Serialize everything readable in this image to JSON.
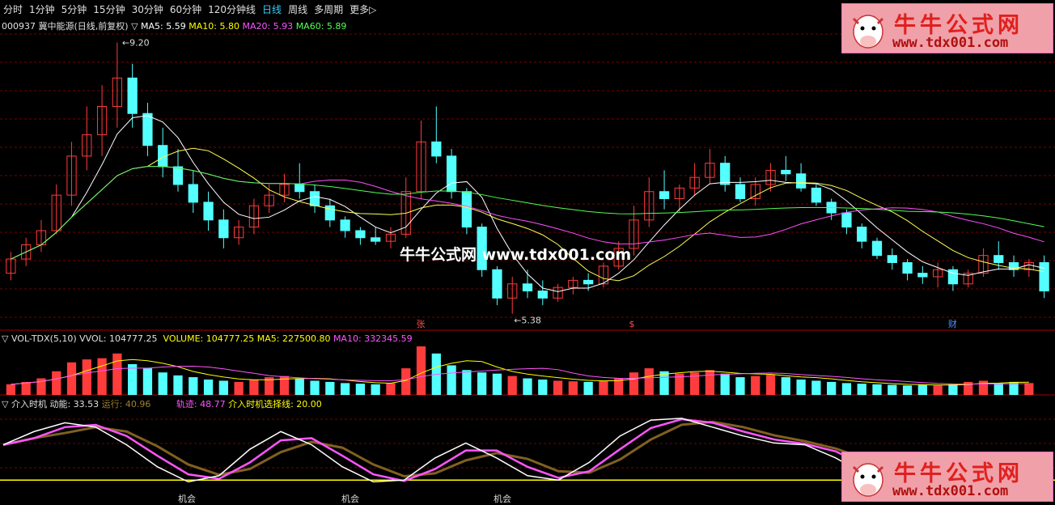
{
  "tabs": [
    "分时",
    "1分钟",
    "5分钟",
    "15分钟",
    "30分钟",
    "60分钟",
    "120分钟线",
    "日线",
    "周线",
    "多周期",
    "更多▷"
  ],
  "active_tab": "日线",
  "price_panel": {
    "title": "000937 冀中能源(日线,前复权) ▽",
    "ma5": "MA5: 5.59",
    "ma10": "MA10: 5.80",
    "ma20": "MA20: 5.93",
    "ma60": "MA60: 5.89",
    "high_label": "9.20",
    "low_label": "5.38",
    "markers": [
      "张",
      "$",
      "财"
    ]
  },
  "vol_panel": {
    "name": "▽ VOL-TDX(5,10)",
    "vvol": "VVOL: 104777.25",
    "volume": "VOLUME: 104777.25",
    "ma5": "MA5: 227500.80",
    "ma10": "MA10: 332345.59"
  },
  "ind_panel": {
    "name": "▽ 介入时机",
    "dongneng": "动能: 33.53",
    "yunxing": "运行: 40.96",
    "guiji": "轨迹: 48.77",
    "xuanze": "介入时机选择线: 20.00",
    "signals": [
      "机会",
      "机会",
      "机会"
    ]
  },
  "watermark": {
    "cn": "牛牛公式网",
    "url": "www.tdx001.com",
    "center": "牛牛公式网  www.tdx001.com"
  },
  "colors": {
    "up": "#ff3c3c",
    "down": "#54ffff",
    "ma5": "#ffffff",
    "ma10": "#ffff50",
    "ma20": "#ff50ff",
    "ma60": "#50ff50",
    "grid": "#7a0000"
  },
  "chart_data": {
    "type": "candlestick",
    "price_range": [
      5.38,
      9.2
    ],
    "candles": [
      {
        "o": 5.95,
        "h": 6.25,
        "l": 5.85,
        "c": 6.15
      },
      {
        "o": 6.15,
        "h": 6.45,
        "l": 6.05,
        "c": 6.35
      },
      {
        "o": 6.35,
        "h": 6.7,
        "l": 6.25,
        "c": 6.55
      },
      {
        "o": 6.55,
        "h": 7.2,
        "l": 6.5,
        "c": 7.05
      },
      {
        "o": 7.05,
        "h": 7.8,
        "l": 6.9,
        "c": 7.6
      },
      {
        "o": 7.6,
        "h": 8.3,
        "l": 7.4,
        "c": 7.9
      },
      {
        "o": 7.9,
        "h": 8.6,
        "l": 7.6,
        "c": 8.3
      },
      {
        "o": 8.3,
        "h": 9.2,
        "l": 8.0,
        "c": 8.7
      },
      {
        "o": 8.7,
        "h": 8.9,
        "l": 8.0,
        "c": 8.2
      },
      {
        "o": 8.2,
        "h": 8.35,
        "l": 7.6,
        "c": 7.75
      },
      {
        "o": 7.75,
        "h": 8.0,
        "l": 7.3,
        "c": 7.45
      },
      {
        "o": 7.45,
        "h": 7.7,
        "l": 7.1,
        "c": 7.2
      },
      {
        "o": 7.2,
        "h": 7.4,
        "l": 6.8,
        "c": 6.95
      },
      {
        "o": 6.95,
        "h": 7.1,
        "l": 6.55,
        "c": 6.7
      },
      {
        "o": 6.7,
        "h": 6.85,
        "l": 6.3,
        "c": 6.45
      },
      {
        "o": 6.45,
        "h": 6.7,
        "l": 6.35,
        "c": 6.6
      },
      {
        "o": 6.6,
        "h": 7.0,
        "l": 6.5,
        "c": 6.9
      },
      {
        "o": 6.9,
        "h": 7.2,
        "l": 6.8,
        "c": 7.05
      },
      {
        "o": 7.05,
        "h": 7.35,
        "l": 6.95,
        "c": 7.2
      },
      {
        "o": 7.2,
        "h": 7.5,
        "l": 7.0,
        "c": 7.1
      },
      {
        "o": 7.1,
        "h": 7.2,
        "l": 6.8,
        "c": 6.9
      },
      {
        "o": 6.9,
        "h": 7.0,
        "l": 6.6,
        "c": 6.7
      },
      {
        "o": 6.7,
        "h": 6.75,
        "l": 6.45,
        "c": 6.55
      },
      {
        "o": 6.55,
        "h": 6.6,
        "l": 6.35,
        "c": 6.45
      },
      {
        "o": 6.45,
        "h": 6.6,
        "l": 6.35,
        "c": 6.4
      },
      {
        "o": 6.4,
        "h": 6.6,
        "l": 6.3,
        "c": 6.5
      },
      {
        "o": 6.5,
        "h": 7.3,
        "l": 6.45,
        "c": 7.1
      },
      {
        "o": 7.1,
        "h": 8.1,
        "l": 7.0,
        "c": 7.8
      },
      {
        "o": 7.8,
        "h": 8.3,
        "l": 7.5,
        "c": 7.6
      },
      {
        "o": 7.6,
        "h": 7.7,
        "l": 7.0,
        "c": 7.1
      },
      {
        "o": 7.1,
        "h": 7.15,
        "l": 6.5,
        "c": 6.6
      },
      {
        "o": 6.6,
        "h": 6.65,
        "l": 5.9,
        "c": 6.0
      },
      {
        "o": 6.0,
        "h": 6.05,
        "l": 5.5,
        "c": 5.6
      },
      {
        "o": 5.6,
        "h": 5.9,
        "l": 5.38,
        "c": 5.8
      },
      {
        "o": 5.8,
        "h": 6.0,
        "l": 5.6,
        "c": 5.7
      },
      {
        "o": 5.7,
        "h": 5.85,
        "l": 5.5,
        "c": 5.6
      },
      {
        "o": 5.6,
        "h": 5.8,
        "l": 5.55,
        "c": 5.75
      },
      {
        "o": 5.75,
        "h": 5.9,
        "l": 5.65,
        "c": 5.85
      },
      {
        "o": 5.85,
        "h": 5.95,
        "l": 5.7,
        "c": 5.8
      },
      {
        "o": 5.8,
        "h": 6.1,
        "l": 5.75,
        "c": 6.05
      },
      {
        "o": 6.05,
        "h": 6.4,
        "l": 6.0,
        "c": 6.3
      },
      {
        "o": 6.3,
        "h": 6.9,
        "l": 6.2,
        "c": 6.7
      },
      {
        "o": 6.7,
        "h": 7.3,
        "l": 6.6,
        "c": 7.1
      },
      {
        "o": 7.1,
        "h": 7.4,
        "l": 6.85,
        "c": 7.0
      },
      {
        "o": 7.0,
        "h": 7.2,
        "l": 6.8,
        "c": 7.15
      },
      {
        "o": 7.15,
        "h": 7.5,
        "l": 7.05,
        "c": 7.3
      },
      {
        "o": 7.3,
        "h": 7.7,
        "l": 7.2,
        "c": 7.5
      },
      {
        "o": 7.5,
        "h": 7.6,
        "l": 7.1,
        "c": 7.2
      },
      {
        "o": 7.2,
        "h": 7.3,
        "l": 6.95,
        "c": 7.0
      },
      {
        "o": 7.0,
        "h": 7.3,
        "l": 6.9,
        "c": 7.2
      },
      {
        "o": 7.2,
        "h": 7.5,
        "l": 7.1,
        "c": 7.4
      },
      {
        "o": 7.4,
        "h": 7.6,
        "l": 7.25,
        "c": 7.35
      },
      {
        "o": 7.35,
        "h": 7.5,
        "l": 7.1,
        "c": 7.15
      },
      {
        "o": 7.15,
        "h": 7.2,
        "l": 6.9,
        "c": 6.95
      },
      {
        "o": 6.95,
        "h": 7.0,
        "l": 6.7,
        "c": 6.8
      },
      {
        "o": 6.8,
        "h": 6.85,
        "l": 6.5,
        "c": 6.6
      },
      {
        "o": 6.6,
        "h": 6.65,
        "l": 6.3,
        "c": 6.4
      },
      {
        "o": 6.4,
        "h": 6.45,
        "l": 6.15,
        "c": 6.2
      },
      {
        "o": 6.2,
        "h": 6.3,
        "l": 6.0,
        "c": 6.1
      },
      {
        "o": 6.1,
        "h": 6.15,
        "l": 5.85,
        "c": 5.95
      },
      {
        "o": 5.95,
        "h": 6.05,
        "l": 5.8,
        "c": 5.9
      },
      {
        "o": 5.9,
        "h": 6.1,
        "l": 5.75,
        "c": 6.0
      },
      {
        "o": 6.0,
        "h": 6.05,
        "l": 5.7,
        "c": 5.8
      },
      {
        "o": 5.8,
        "h": 6.0,
        "l": 5.75,
        "c": 5.95
      },
      {
        "o": 5.95,
        "h": 6.3,
        "l": 5.9,
        "c": 6.2
      },
      {
        "o": 6.2,
        "h": 6.4,
        "l": 6.0,
        "c": 6.1
      },
      {
        "o": 6.1,
        "h": 6.2,
        "l": 5.9,
        "c": 6.0
      },
      {
        "o": 6.0,
        "h": 6.15,
        "l": 5.9,
        "c": 6.1
      },
      {
        "o": 6.1,
        "h": 6.2,
        "l": 5.6,
        "c": 5.7
      }
    ],
    "volume": [
      18,
      22,
      28,
      40,
      55,
      60,
      62,
      70,
      52,
      45,
      38,
      33,
      30,
      26,
      24,
      22,
      26,
      30,
      32,
      28,
      24,
      22,
      20,
      19,
      18,
      20,
      45,
      82,
      70,
      50,
      42,
      38,
      36,
      32,
      28,
      26,
      24,
      23,
      22,
      24,
      28,
      38,
      45,
      40,
      36,
      38,
      42,
      36,
      30,
      32,
      34,
      30,
      26,
      24,
      22,
      20,
      19,
      18,
      17,
      16,
      17,
      16,
      18,
      22,
      24,
      20,
      22,
      20
    ],
    "indicator": {
      "guiji": [
        60,
        75,
        85,
        80,
        60,
        35,
        18,
        25,
        55,
        75,
        60,
        35,
        18,
        20,
        45,
        62,
        45,
        25,
        20,
        40,
        70,
        88,
        90,
        80,
        70,
        62,
        60,
        45,
        25,
        12,
        10,
        20,
        35,
        45,
        50
      ],
      "xuanze": 20
    }
  }
}
